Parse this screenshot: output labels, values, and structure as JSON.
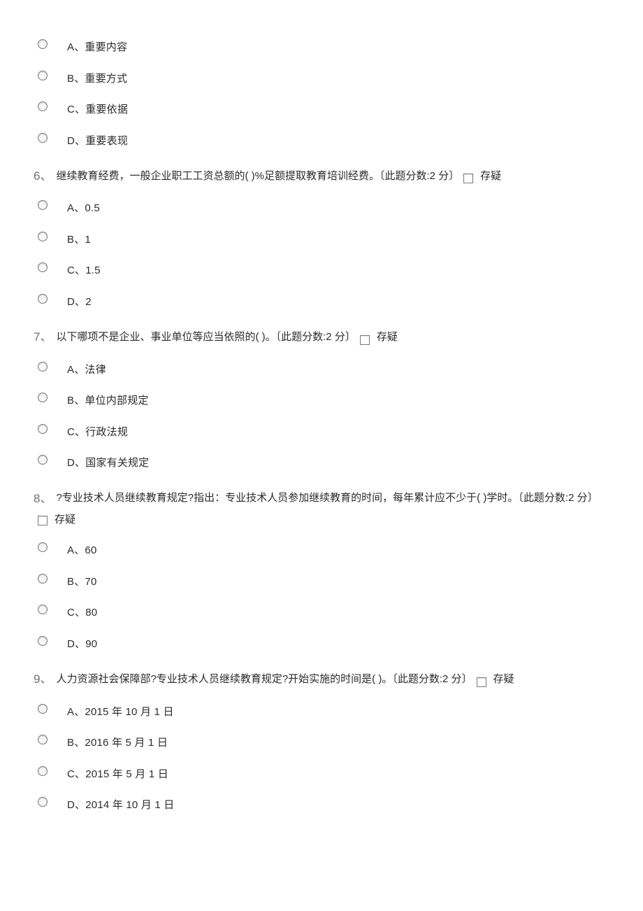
{
  "doubt_label": "存疑",
  "partial_top_options": [
    "A、重要内容",
    "B、重要方式",
    "C、重要依据",
    "D、重要表现"
  ],
  "questions": [
    {
      "num": "6、",
      "text": "继续教育经费，一般企业职工工资总额的( )%足额提取教育培训经费。〔此题分数:2 分〕",
      "options": [
        "A、0.5",
        "B、1",
        "C、1.5",
        "D、2"
      ]
    },
    {
      "num": "7、",
      "text": "以下哪项不是企业、事业单位等应当依照的( )。〔此题分数:2 分〕",
      "options": [
        "A、法律",
        "B、单位内部规定",
        "C、行政法规",
        "D、国家有关规定"
      ]
    },
    {
      "num": "8、",
      "text": "?专业技术人员继续教育规定?指出：专业技术人员参加继续教育的时间，每年累计应不少于( )学时。〔此题分数:2 分〕",
      "options": [
        "A、60",
        "B、70",
        "C、80",
        "D、90"
      ]
    },
    {
      "num": "9、",
      "text": "人力资源社会保障部?专业技术人员继续教育规定?开始实施的时间是( )。〔此题分数:2 分〕",
      "options": [
        "A、2015 年 10 月 1 日",
        "B、2016 年 5 月 1 日",
        "C、2015 年 5 月 1 日",
        "D、2014 年 10 月 1 日"
      ]
    }
  ]
}
